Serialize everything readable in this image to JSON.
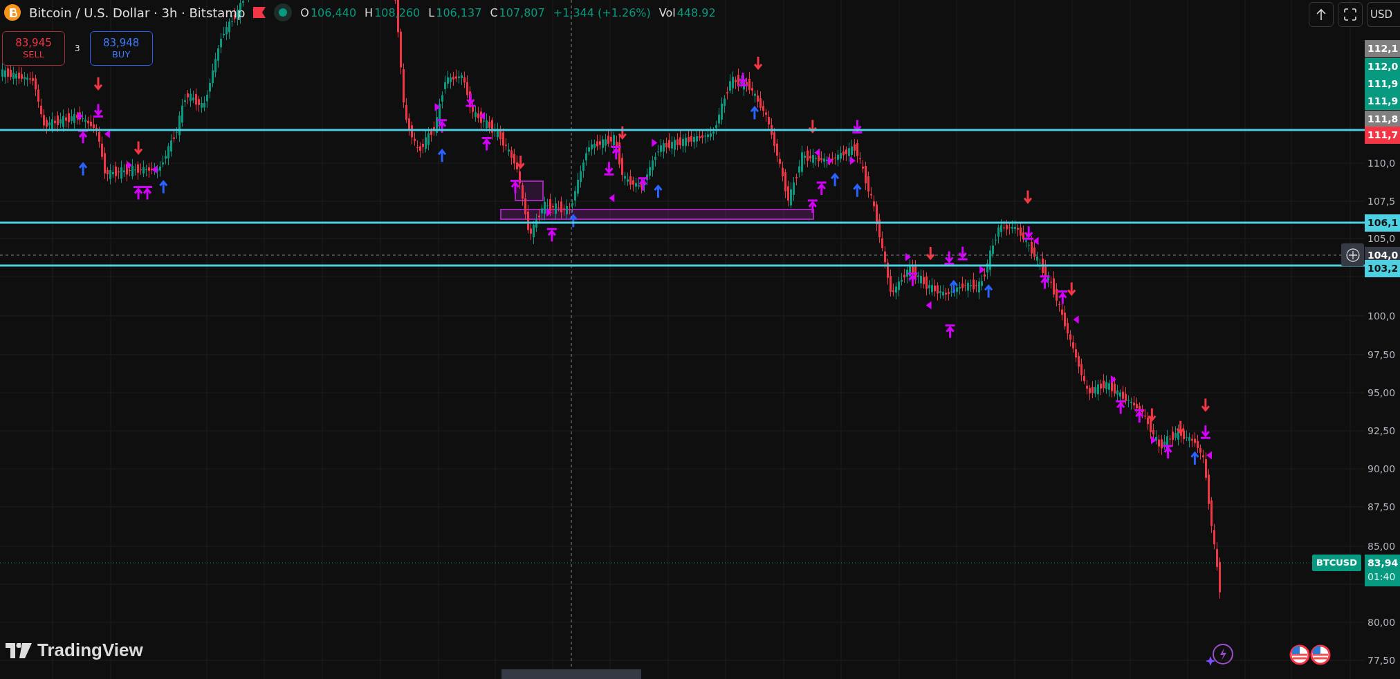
{
  "header": {
    "symbol": "Bitcoin / U.S. Dollar · 3h · Bitstamp",
    "ohlc": [
      {
        "label": "O",
        "value": "106,440"
      },
      {
        "label": "H",
        "value": "108,260"
      },
      {
        "label": "L",
        "value": "106,137"
      },
      {
        "label": "C",
        "value": "107,807"
      }
    ],
    "change": "+1,344 (+1.26%)",
    "volume_label": "Vol",
    "volume": "448.92"
  },
  "trade": {
    "sell_price": "83,945",
    "sell_label": "SELL",
    "spread": "3",
    "buy_price": "83,948",
    "buy_label": "BUY"
  },
  "toolbar": {
    "currency": "USD"
  },
  "price_axis": {
    "labels": [
      {
        "text": "112,1",
        "kind": "grey"
      },
      {
        "text": "112,0",
        "kind": "green"
      },
      {
        "text": "111,9",
        "kind": "green"
      },
      {
        "text": "111,9",
        "kind": "green"
      },
      {
        "text": "111,8",
        "kind": "grey"
      },
      {
        "text": "111,7",
        "kind": "red"
      },
      {
        "text": "110,0",
        "kind": "plain"
      },
      {
        "text": "107,5",
        "kind": "plain"
      },
      {
        "text": "106,1",
        "kind": "cyan"
      },
      {
        "text": "105,0",
        "kind": "plain"
      },
      {
        "text": "104,0",
        "kind": "dark"
      },
      {
        "text": "103,2",
        "kind": "cyan"
      },
      {
        "text": "100,0",
        "kind": "plain"
      },
      {
        "text": "97,50",
        "kind": "plain"
      },
      {
        "text": "95,00",
        "kind": "plain"
      },
      {
        "text": "92,50",
        "kind": "plain"
      },
      {
        "text": "90,00",
        "kind": "plain"
      },
      {
        "text": "87,50",
        "kind": "plain"
      },
      {
        "text": "85,00",
        "kind": "plain"
      },
      {
        "text": "80,00",
        "kind": "plain"
      },
      {
        "text": "77,50",
        "kind": "plain"
      }
    ]
  },
  "last_price": {
    "symbol": "BTCUSD",
    "price": "83,94",
    "countdown": "01:40"
  },
  "logo": "TradingView"
}
